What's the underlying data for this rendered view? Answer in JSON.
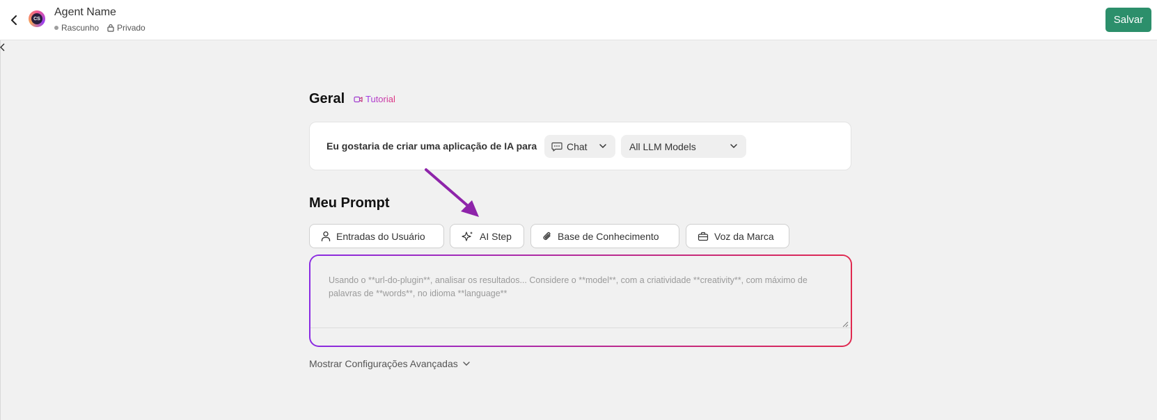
{
  "header": {
    "agent_name": "Agent Name",
    "status": "Rascunho",
    "visibility": "Privado",
    "save_label": "Salvar",
    "avatar_text": "CS",
    "icons": [
      "chevron-left-icon",
      "lock-icon"
    ]
  },
  "geral": {
    "title": "Geral",
    "tutorial_label": "Tutorial",
    "intent_label": "Eu gostaria de criar uma aplicação de IA para",
    "type_select": "Chat",
    "model_select": "All LLM Models"
  },
  "prompt": {
    "title": "Meu Prompt",
    "chips": [
      "Entradas do Usuário",
      "AI Step",
      "Base de Conhecimento",
      "Voz da Marca"
    ],
    "placeholder": "Usando o **url-do-plugin**, analisar os resultados... Considere o **model**, com a criatividade **creativity**, com máximo de palavras de **words**, no idioma **language**"
  },
  "advanced_label": "Mostrar Configurações Avançadas",
  "colors": {
    "save": "#2c8f6b",
    "gradient_start": "#8a2be2",
    "gradient_end": "#e0294f",
    "annotation_arrow": "#8e24aa"
  }
}
